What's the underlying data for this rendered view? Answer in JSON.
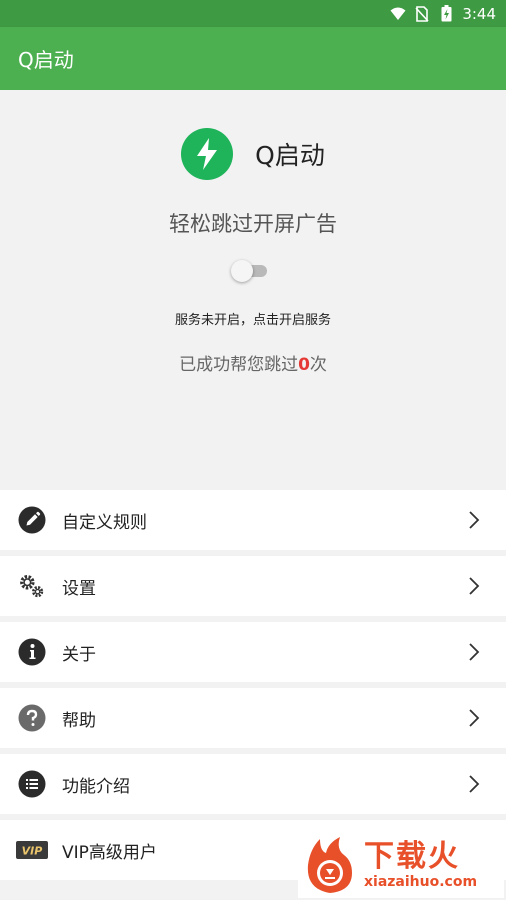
{
  "status_bar": {
    "time": "3:44",
    "icons": [
      "wifi-icon",
      "no-sim-icon",
      "battery-charging-icon"
    ]
  },
  "app_bar": {
    "title": "Q启动"
  },
  "hero": {
    "app_name": "Q启动",
    "tagline": "轻松跳过开屏广告",
    "service_toggle_on": false,
    "service_status": "服务未开启，点击开启服务",
    "skip_count_prefix": "已成功帮您跳过",
    "skip_count": "0",
    "skip_count_suffix": "次"
  },
  "menu": {
    "items": [
      {
        "label": "自定义规则",
        "icon": "edit-pencil-icon"
      },
      {
        "label": "设置",
        "icon": "gears-icon"
      },
      {
        "label": "关于",
        "icon": "info-icon"
      },
      {
        "label": "帮助",
        "icon": "help-question-icon"
      },
      {
        "label": "功能介绍",
        "icon": "list-icon"
      },
      {
        "label": "VIP高级用户",
        "icon": "vip-badge-icon"
      }
    ]
  },
  "watermark": {
    "brand": "下载火",
    "domain": "xiazaihuo.com"
  },
  "colors": {
    "app_bar": "#4caf50",
    "status_bar": "#3f9b43",
    "logo": "#1fb35a",
    "count_highlight": "#e53935",
    "watermark": "#e8502a"
  }
}
